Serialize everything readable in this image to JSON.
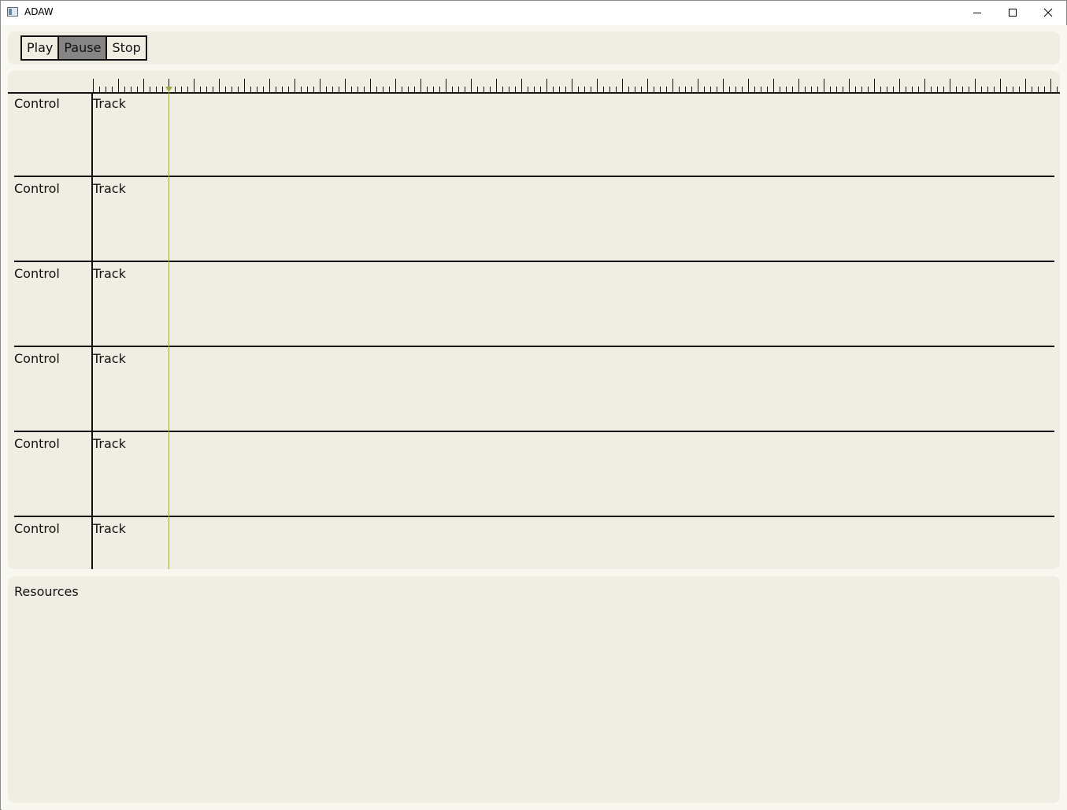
{
  "window": {
    "title": "ADAW",
    "icon": "app-window-icon",
    "controls": [
      "minimize-icon",
      "maximize-icon",
      "close-icon"
    ]
  },
  "transport": {
    "buttons": [
      {
        "label": "Play",
        "active": false
      },
      {
        "label": "Pause",
        "active": true
      },
      {
        "label": "Stop",
        "active": false
      }
    ],
    "active_color": "#858585"
  },
  "timeline": {
    "tracks": [
      {
        "control": "Control",
        "track": "Track"
      },
      {
        "control": "Control",
        "track": "Track"
      },
      {
        "control": "Control",
        "track": "Track"
      },
      {
        "control": "Control",
        "track": "Track"
      },
      {
        "control": "Control",
        "track": "Track"
      },
      {
        "control": "Control",
        "track": "Track"
      }
    ],
    "playhead_color": "#9fa84a"
  },
  "resources": {
    "title": "Resources"
  },
  "colors": {
    "panel_bg": "#f0eee3",
    "app_bg": "#f8f8f1",
    "line": "#111111"
  }
}
